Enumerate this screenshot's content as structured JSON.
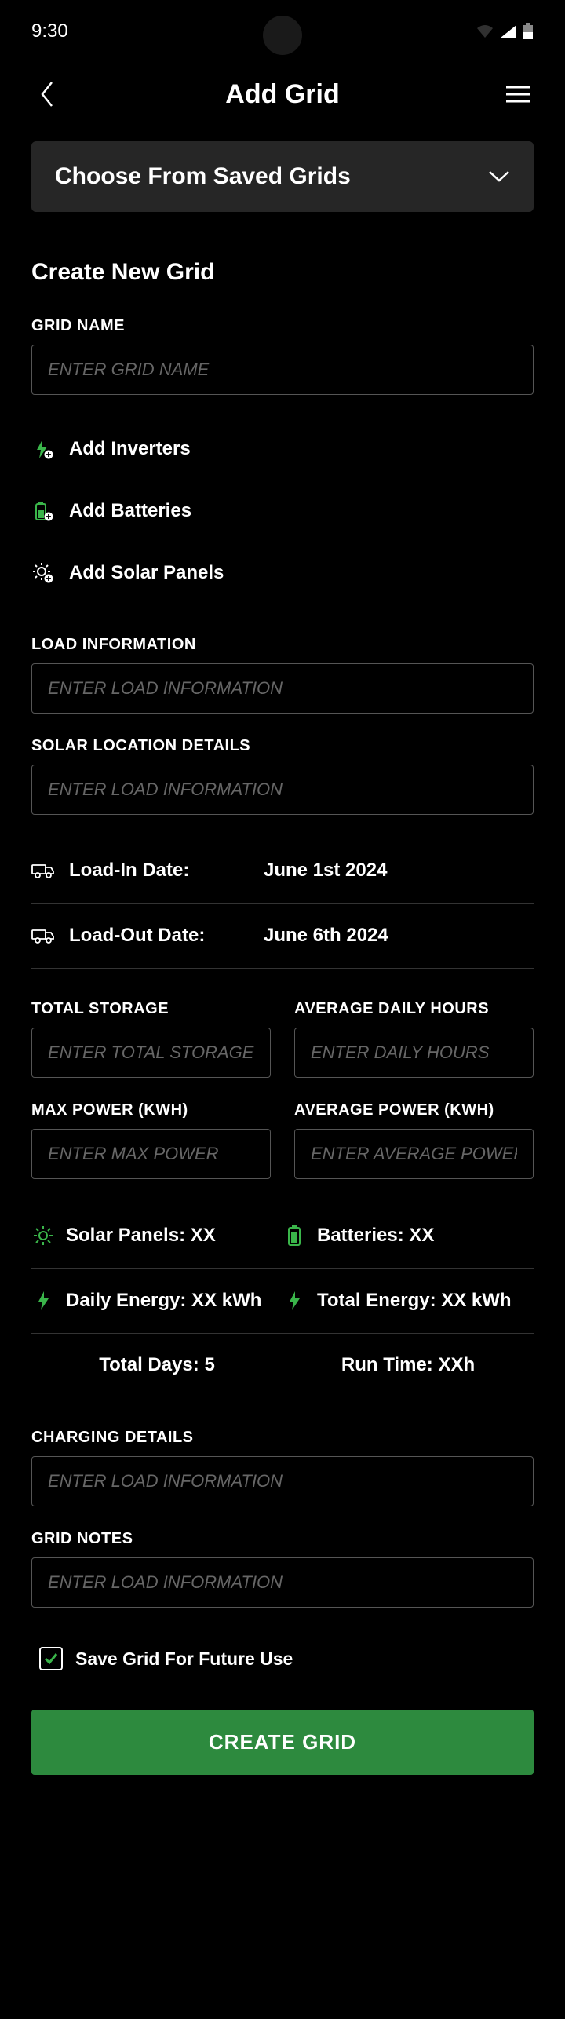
{
  "status": {
    "time": "9:30"
  },
  "header": {
    "title": "Add Grid"
  },
  "savedGrids": {
    "label": "Choose From Saved Grids"
  },
  "sectionTitle": "Create New Grid",
  "fields": {
    "gridName": {
      "label": "GRID NAME",
      "placeholder": "ENTER GRID NAME"
    },
    "loadInfo": {
      "label": "LOAD INFORMATION",
      "placeholder": "ENTER LOAD INFORMATION"
    },
    "solarLoc": {
      "label": "SOLAR LOCATION DETAILS",
      "placeholder": "ENTER LOAD INFORMATION"
    },
    "totalStorage": {
      "label": "TOTAL STORAGE",
      "placeholder": "ENTER TOTAL STORAGE"
    },
    "dailyHours": {
      "label": "AVERAGE DAILY HOURS",
      "placeholder": "ENTER DAILY HOURS"
    },
    "maxPower": {
      "label": "MAX POWER (KWH)",
      "placeholder": "ENTER MAX POWER"
    },
    "avgPower": {
      "label": "AVERAGE POWER (KWH)",
      "placeholder": "ENTER AVERAGE POWER"
    },
    "charging": {
      "label": "CHARGING DETAILS",
      "placeholder": "ENTER LOAD INFORMATION"
    },
    "notes": {
      "label": "GRID NOTES",
      "placeholder": "ENTER LOAD INFORMATION"
    }
  },
  "addRows": {
    "inverters": "Add Inverters",
    "batteries": "Add Batteries",
    "solar": "Add Solar Panels"
  },
  "dates": {
    "loadIn": {
      "label": "Load-In Date:",
      "value": "June 1st 2024"
    },
    "loadOut": {
      "label": "Load-Out Date:",
      "value": "June 6th 2024"
    }
  },
  "stats": {
    "solarPanels": "Solar Panels: XX",
    "batteries": "Batteries: XX",
    "dailyEnergy": "Daily Energy: XX kWh",
    "totalEnergy": "Total Energy: XX kWh",
    "totalDays": "Total Days: 5",
    "runTime": "Run Time: XXh"
  },
  "checkbox": {
    "label": "Save Grid For Future Use",
    "checked": true
  },
  "button": {
    "create": "CREATE GRID"
  },
  "colors": {
    "accent": "#3ab54a",
    "button": "#2d8a3e"
  }
}
